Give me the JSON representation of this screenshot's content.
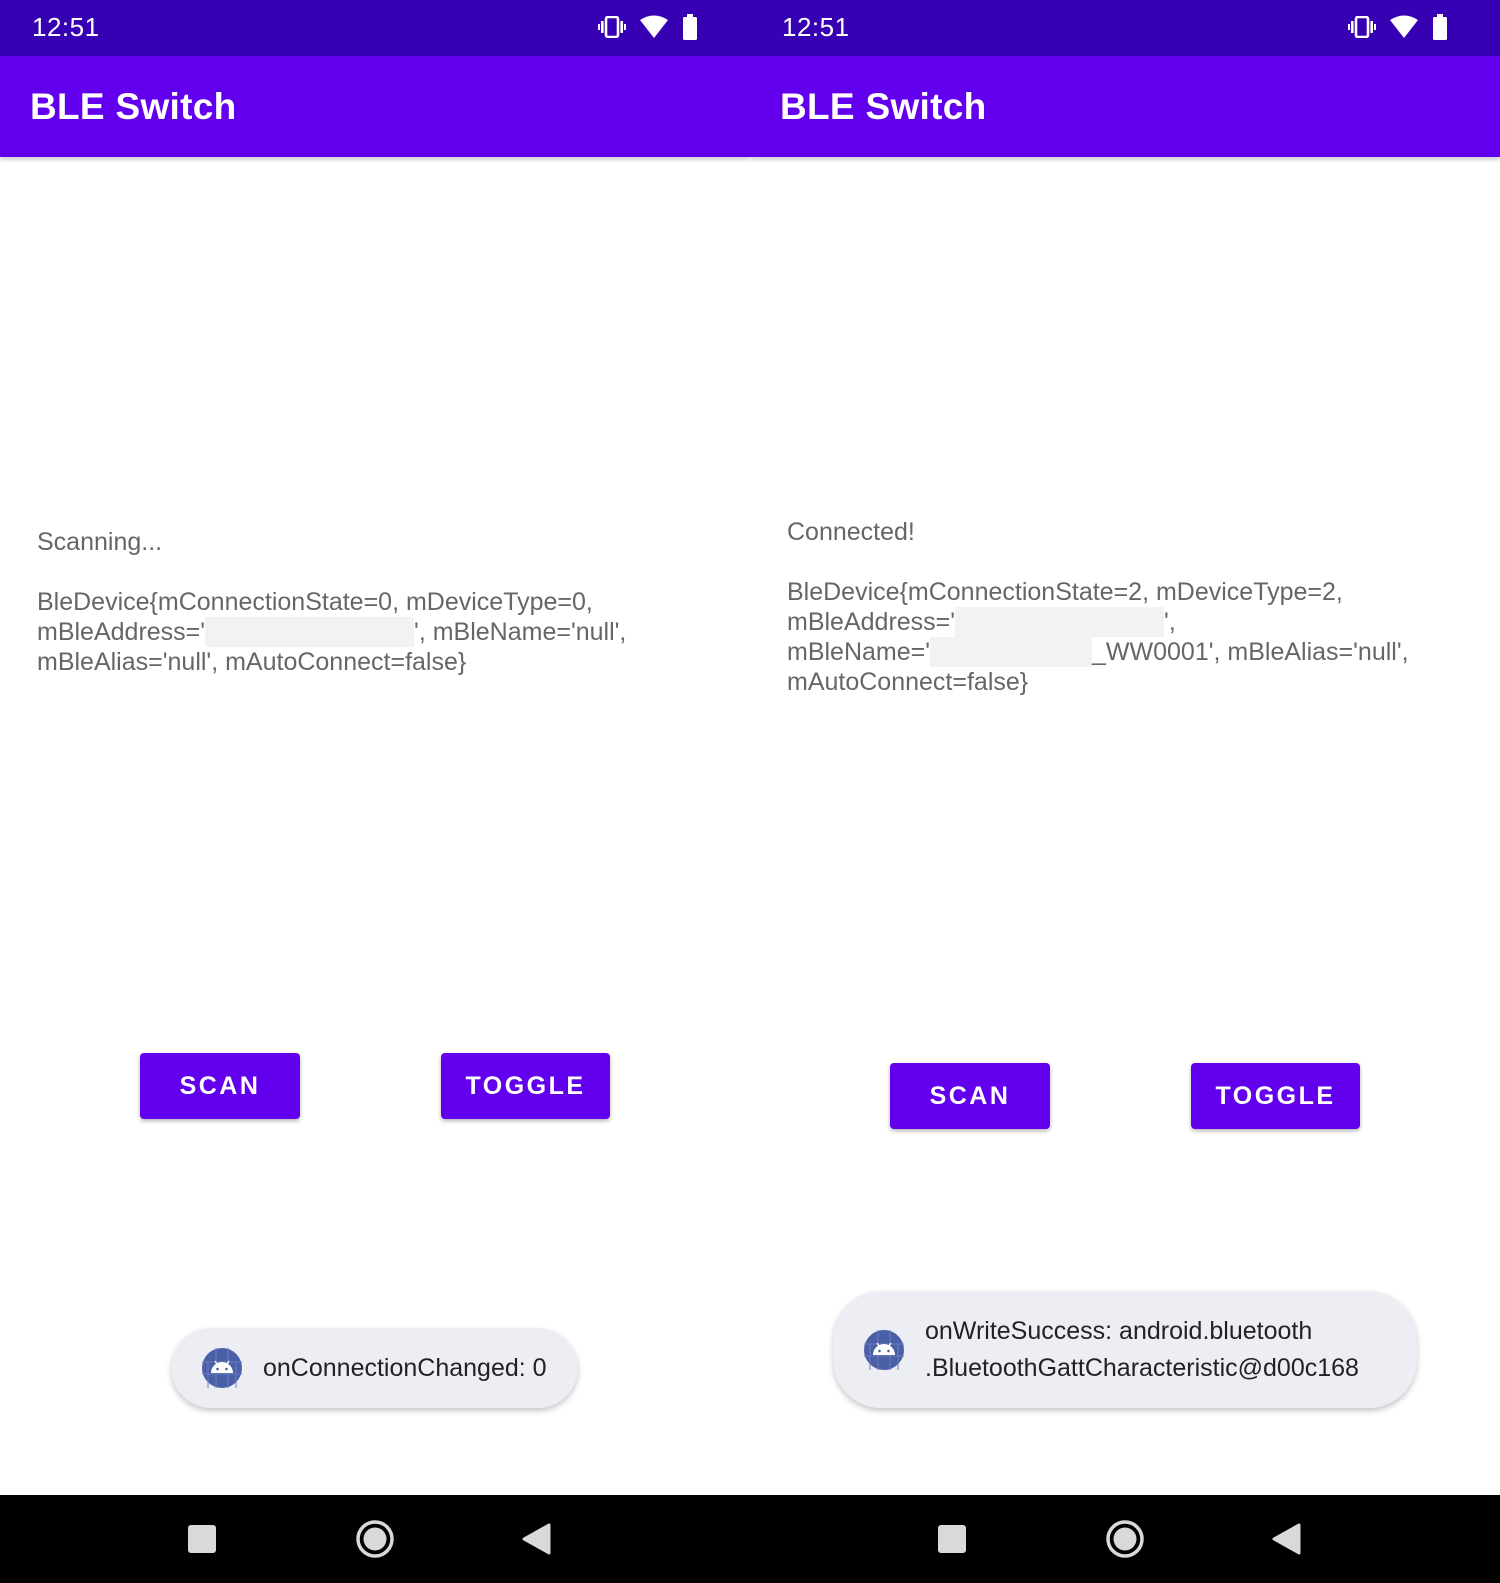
{
  "screens": [
    {
      "status_bar": {
        "time": "12:51",
        "icons": [
          "vibrate-icon",
          "wifi-icon",
          "battery-icon"
        ]
      },
      "app_bar": {
        "title": "BLE Switch"
      },
      "content": {
        "status_text": "Scanning...",
        "device": {
          "line1": "BleDevice{mConnectionState=0, mDeviceType=0,",
          "line2_prefix": "mBleAddress='",
          "line2_suffix": "', mBleName='null',",
          "line3": "mBleAlias='null', mAutoConnect=false}"
        }
      },
      "buttons": {
        "scan": "SCAN",
        "toggle": "TOGGLE"
      },
      "toast": {
        "icon": "android-icon",
        "lines": [
          "onConnectionChanged: 0"
        ]
      },
      "nav_bar": {
        "icons": [
          "recents-square-icon",
          "home-circle-icon",
          "back-triangle-icon"
        ]
      }
    },
    {
      "status_bar": {
        "time": "12:51",
        "icons": [
          "vibrate-icon",
          "wifi-icon",
          "battery-icon"
        ]
      },
      "app_bar": {
        "title": "BLE Switch"
      },
      "content": {
        "status_text": "Connected!",
        "device": {
          "line1": "BleDevice{mConnectionState=2, mDeviceType=2,",
          "line2_prefix": "mBleAddress='",
          "line2_suffix": "',",
          "line3_prefix": "mBleName='",
          "line3_suffix": "_WW0001', mBleAlias='null',",
          "line4": "mAutoConnect=false}"
        }
      },
      "buttons": {
        "scan": "SCAN",
        "toggle": "TOGGLE"
      },
      "toast": {
        "icon": "android-icon",
        "lines": [
          "onWriteSuccess: android.bluetooth",
          ".BluetoothGattCharacteristic@d00c168"
        ]
      },
      "nav_bar": {
        "icons": [
          "recents-square-icon",
          "home-circle-icon",
          "back-triangle-icon"
        ]
      }
    }
  ],
  "colors": {
    "status_bar": "#3700b3",
    "app_bar": "#6200ee",
    "button": "#6200ee",
    "body_text": "#666666",
    "toast_bg": "#eceef3",
    "android_icon_bg": "#4a5fa8",
    "nav_bar": "#000000"
  }
}
